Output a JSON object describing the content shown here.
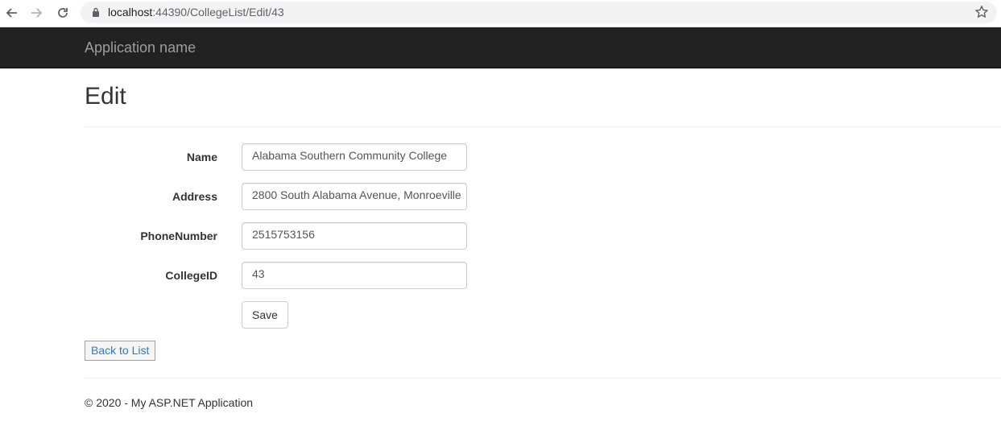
{
  "browser": {
    "url_host": "localhost",
    "url_path": ":44390/CollegeList/Edit/43",
    "icons": [
      "back-arrow-icon",
      "forward-arrow-icon",
      "reload-icon",
      "lock-icon",
      "bookmark-star-icon"
    ]
  },
  "navbar": {
    "brand": "Application name",
    "background": "#222222",
    "brand_color": "#9d9d9d"
  },
  "page": {
    "title": "Edit"
  },
  "form": {
    "fields": [
      {
        "label": "Name",
        "value": "Alabama Southern Community College"
      },
      {
        "label": "Address",
        "value": "2800 South Alabama Avenue, Monroeville"
      },
      {
        "label": "PhoneNumber",
        "value": "2515753156"
      },
      {
        "label": "CollegeID",
        "value": "43"
      }
    ],
    "save_label": "Save"
  },
  "links": {
    "back_to_list": "Back to List",
    "link_color": "#337ab7"
  },
  "footer": {
    "text": "© 2020 - My ASP.NET Application"
  }
}
